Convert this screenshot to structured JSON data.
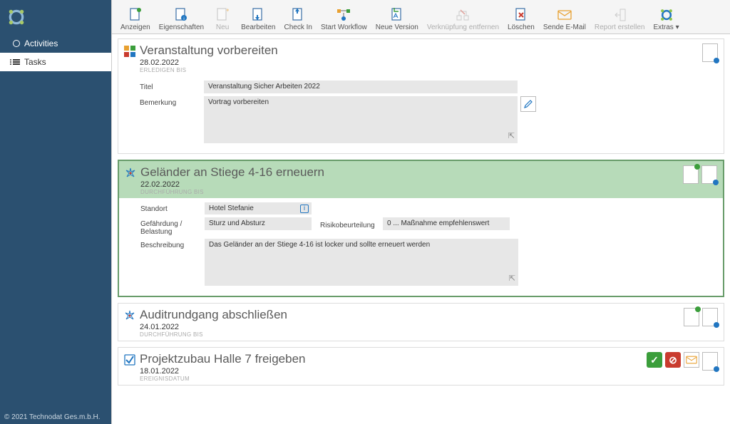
{
  "sidebar": {
    "items": [
      {
        "label": "Activities"
      },
      {
        "label": "Tasks"
      }
    ]
  },
  "footer": "© 2021  Technodat Ges.m.b.H.",
  "toolbar": {
    "show": "Anzeigen",
    "properties": "Eigenschaften",
    "new": "Neu",
    "edit": "Bearbeiten",
    "checkin": "Check In",
    "startwf": "Start Workflow",
    "newversion": "Neue Version",
    "unlink": "Verknüpfung entfernen",
    "delete": "Löschen",
    "sendemail": "Sende E-Mail",
    "report": "Report erstellen",
    "extras": "Extras ▾"
  },
  "tasks": [
    {
      "title": "Veranstaltung vorbereiten",
      "date": "28.02.2022",
      "date_label": "ERLEDIGEN BIS",
      "form": {
        "label_title": "Titel",
        "value_title": "Veranstaltung Sicher Arbeiten 2022",
        "label_remark": "Bemerkung",
        "value_remark": "Vortrag vorbereiten"
      }
    },
    {
      "title": "Geländer an Stiege 4-16 erneuern",
      "date": "22.02.2022",
      "date_label": "DURCHFÜHRUNG BIS",
      "form": {
        "label_location": "Standort",
        "value_location": "Hotel Stefanie",
        "label_hazard": "Gefährdung / Belastung",
        "value_hazard": "Sturz und Absturz",
        "label_risk": "Risikobeurteilung",
        "value_risk": "0 ... Maßnahme empfehlenswert",
        "label_desc": "Beschreibung",
        "value_desc": "Das Geländer an der Stiege 4-16 ist locker und sollte erneuert werden"
      }
    },
    {
      "title": "Auditrundgang abschließen",
      "date": "24.01.2022",
      "date_label": "DURCHFÜHRUNG BIS"
    },
    {
      "title": "Projektzubau Halle 7 freigeben",
      "date": "18.01.2022",
      "date_label": "EREIGNISDATUM"
    }
  ]
}
